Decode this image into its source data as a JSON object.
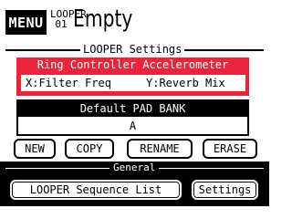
{
  "header": {
    "menu_label": "MENU",
    "looper_label": "LOOPER",
    "looper_number": "01",
    "title": "Empty"
  },
  "looper_settings": {
    "section_label": "LOOPER Settings",
    "ring_controller": {
      "label": "Ring Controller Accelerometer",
      "x_assignment": "X:Filter Freq",
      "y_assignment": "Y:Reverb Mix"
    },
    "pad_bank": {
      "label": "Default PAD BANK",
      "value": "A"
    },
    "buttons": {
      "new": "NEW",
      "copy": "COPY",
      "rename": "RENAME",
      "erase": "ERASE"
    }
  },
  "general": {
    "section_label": "General",
    "sequence_list_label": "LOOPER Sequence List",
    "settings_label": "Settings"
  },
  "colors": {
    "accent_red": "#e8253a",
    "background": "#ffffff",
    "foreground": "#000000"
  }
}
